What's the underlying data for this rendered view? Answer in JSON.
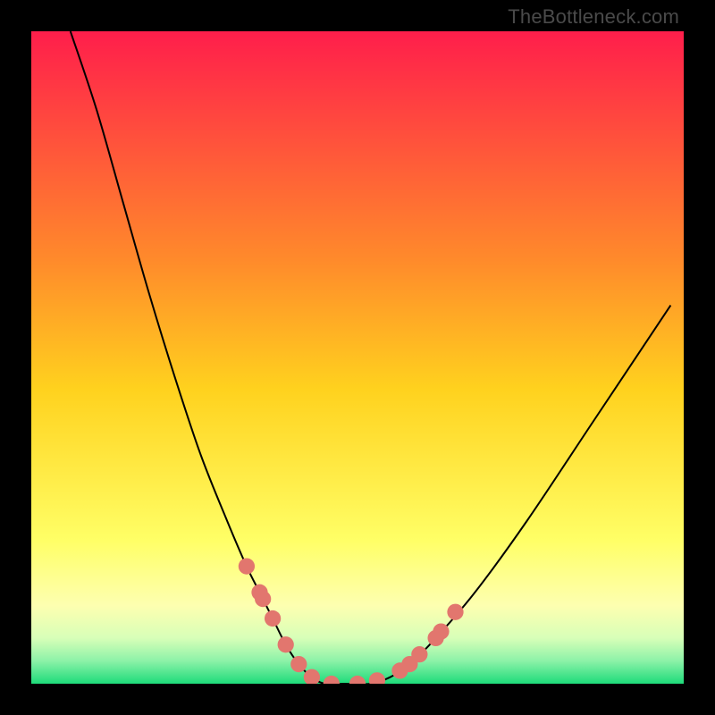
{
  "watermark": "TheBottleneck.com",
  "chart_data": {
    "type": "line",
    "title": "",
    "xlabel": "",
    "ylabel": "",
    "xlim": [
      0,
      100
    ],
    "ylim": [
      0,
      100
    ],
    "series": [
      {
        "name": "bottleneck-curve",
        "x": [
          6,
          10,
          14,
          18,
          22,
          26,
          30,
          33,
          35,
          37,
          39,
          41,
          43,
          45,
          48,
          52,
          55,
          58,
          62,
          68,
          76,
          86,
          98
        ],
        "y": [
          100,
          88,
          74,
          60,
          47,
          35,
          25,
          18,
          14,
          10,
          6,
          3,
          1,
          0,
          0,
          0,
          1,
          3,
          7,
          14,
          25,
          40,
          58
        ]
      }
    ],
    "markers": {
      "name": "highlighted-points",
      "x": [
        33,
        35,
        35.5,
        37,
        39,
        41,
        43,
        46,
        50,
        53,
        56.5,
        58,
        59.5,
        62,
        62.8,
        65
      ],
      "y": [
        18,
        14,
        13,
        10,
        6,
        3,
        1,
        0,
        0,
        0.5,
        2,
        3,
        4.5,
        7,
        8,
        11
      ]
    },
    "gradient_stops": [
      {
        "offset": 0.0,
        "color": "#ff1e4b"
      },
      {
        "offset": 0.35,
        "color": "#ff8a2b"
      },
      {
        "offset": 0.55,
        "color": "#ffd21e"
      },
      {
        "offset": 0.78,
        "color": "#ffff66"
      },
      {
        "offset": 0.88,
        "color": "#fdffb0"
      },
      {
        "offset": 0.93,
        "color": "#d8ffb8"
      },
      {
        "offset": 0.965,
        "color": "#8cf2a8"
      },
      {
        "offset": 1.0,
        "color": "#1edb7a"
      }
    ],
    "marker_color": "#e2766e",
    "curve_color": "#000000"
  }
}
